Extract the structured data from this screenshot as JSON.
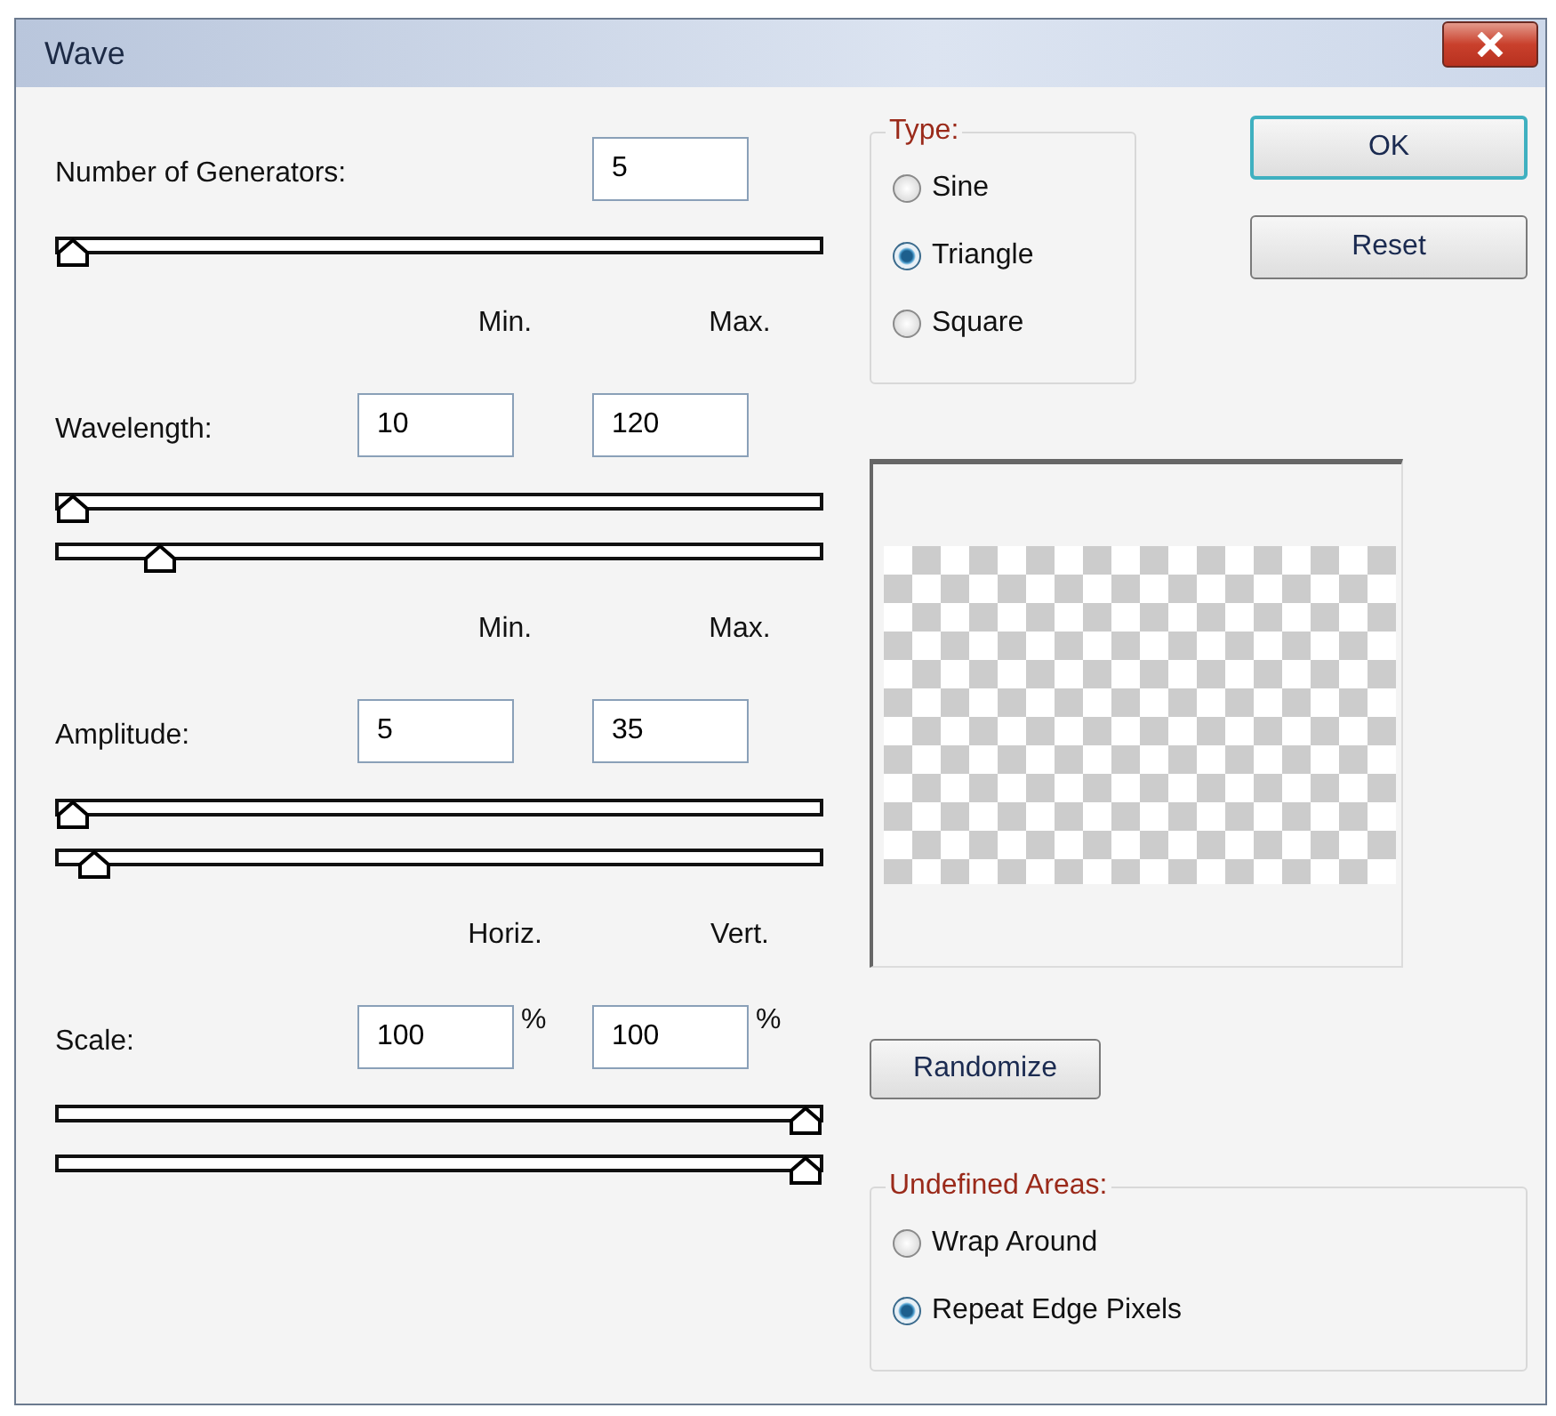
{
  "window": {
    "title": "Wave"
  },
  "parameters": [
    {
      "label": "Number of Generators:",
      "fields": [
        {
          "value": "5"
        }
      ],
      "sliders": [
        {
          "level": 0
        }
      ]
    },
    {
      "headers": [
        "Min.",
        "Max."
      ],
      "label": "Wavelength:",
      "fields": [
        {
          "value": "10"
        },
        {
          "value": "120"
        }
      ],
      "sliders": [
        {
          "level": 0
        },
        {
          "level": 0.12
        }
      ]
    },
    {
      "headers": [
        "Min.",
        "Max."
      ],
      "label": "Amplitude:",
      "fields": [
        {
          "value": "5"
        },
        {
          "value": "35"
        }
      ],
      "sliders": [
        {
          "level": 0
        },
        {
          "level": 0.03
        }
      ]
    },
    {
      "headers": [
        "Horiz.",
        "Vert."
      ],
      "label": "Scale:",
      "fields": [
        {
          "value": "100",
          "unit": "%"
        },
        {
          "value": "100",
          "unit": "%"
        }
      ],
      "sliders": [
        {
          "level": 1
        },
        {
          "level": 1
        }
      ]
    }
  ],
  "type_group": {
    "title": "Type:",
    "options": [
      {
        "label": "Sine",
        "selected": false
      },
      {
        "label": "Triangle",
        "selected": true
      },
      {
        "label": "Square",
        "selected": false
      }
    ]
  },
  "buttons": [
    {
      "label": "OK",
      "default": true
    },
    {
      "label": "Reset",
      "default": false
    }
  ],
  "randomize_button": "Randomize",
  "undefined_areas": {
    "title": "Undefined Areas:",
    "options": [
      {
        "label": "Wrap Around",
        "selected": false
      },
      {
        "label": "Repeat Edge Pixels",
        "selected": true
      }
    ]
  }
}
